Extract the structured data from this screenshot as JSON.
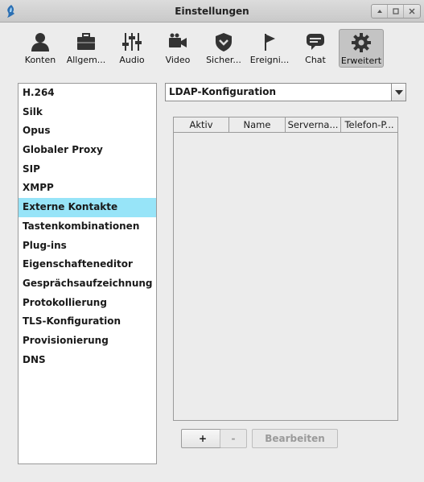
{
  "window": {
    "title": "Einstellungen",
    "controls": [
      "⏶",
      "⏹",
      "✕"
    ]
  },
  "toolbar": {
    "items": [
      {
        "label": "Konten",
        "icon": "user-icon"
      },
      {
        "label": "Allgem...",
        "icon": "briefcase-icon"
      },
      {
        "label": "Audio",
        "icon": "equalizer-icon"
      },
      {
        "label": "Video",
        "icon": "camera-icon"
      },
      {
        "label": "Sicher...",
        "icon": "shield-icon"
      },
      {
        "label": "Ereigni...",
        "icon": "flag-icon"
      },
      {
        "label": "Chat",
        "icon": "chat-bubble-icon"
      },
      {
        "label": "Erweitert",
        "icon": "gear-icon"
      }
    ],
    "active_index": 7
  },
  "nav": {
    "items": [
      "H.264",
      "Silk",
      "Opus",
      "Globaler Proxy",
      "SIP",
      "XMPP",
      "Externe Kontakte",
      "Tastenkombinationen",
      "Plug-ins",
      "Eigenschafteneditor",
      "Gesprächsaufzeichnung",
      "Protokollierung",
      "TLS-Konfiguration",
      "Provisionierung",
      "DNS"
    ],
    "selected_index": 6
  },
  "dropdown": {
    "value": "LDAP-Konfiguration"
  },
  "table": {
    "columns": [
      "Aktiv",
      "Name",
      "Serverna...",
      "Telefon-P..."
    ],
    "rows": []
  },
  "buttons": {
    "add": "+",
    "remove": "-",
    "edit": "Bearbeiten"
  },
  "colors": {
    "selected_row": "#97e4f8",
    "active_tab": "#c4c4c4"
  }
}
